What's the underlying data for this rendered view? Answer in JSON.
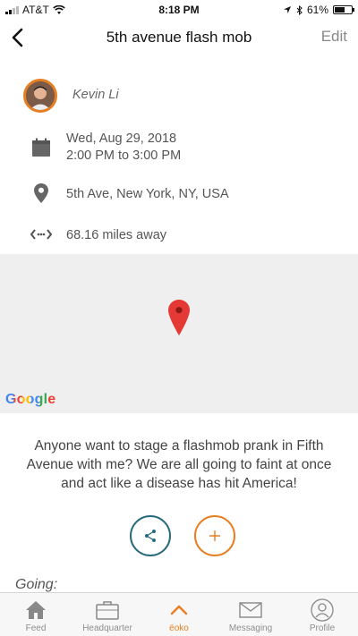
{
  "status_bar": {
    "carrier": "AT&T",
    "time": "8:18 PM",
    "battery": "61%",
    "battery_level": 0.61
  },
  "nav": {
    "title": "5th avenue flash mob",
    "edit_label": "Edit"
  },
  "event": {
    "author": "Kevin Li",
    "date": "Wed, Aug 29, 2018",
    "time_range": "2:00 PM to 3:00 PM",
    "location": "5th Ave, New York, NY, USA",
    "distance": "68.16 miles away",
    "description": "Anyone want to stage a flashmob prank in Fifth Avenue with me? We are all going to faint at once and act like a disease has hit America!"
  },
  "map": {
    "logo": "Google"
  },
  "going_label": "Going:",
  "tabs": [
    {
      "label": "Feed",
      "icon": "home-icon"
    },
    {
      "label": "Headquarter",
      "icon": "briefcase-icon"
    },
    {
      "label": "ëoko",
      "icon": "chevron-up-icon"
    },
    {
      "label": "Messaging",
      "icon": "envelope-icon"
    },
    {
      "label": "Profile",
      "icon": "user-icon"
    }
  ],
  "colors": {
    "accent": "#e67e22",
    "share": "#2a6a7f",
    "pin": "#e53935"
  }
}
